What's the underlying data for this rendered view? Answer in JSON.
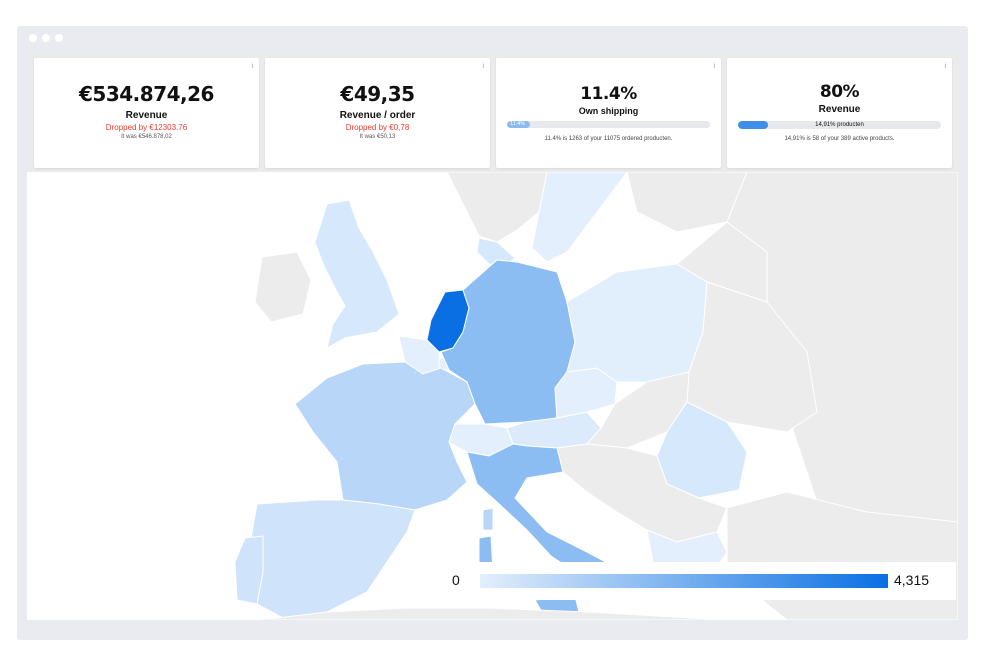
{
  "window": {
    "controls": [
      "close",
      "minimize",
      "maximize"
    ]
  },
  "cards": [
    {
      "value": "€534.874,26",
      "label": "Revenue",
      "change": "Dropped by €12303.76",
      "previous": "It was €546.878,02",
      "info_icon": "i"
    },
    {
      "value": "€49,35",
      "label": "Revenue / order",
      "change": "Dropped by €0,78",
      "previous": "It was €50,13",
      "info_icon": "i"
    },
    {
      "value": "11.4%",
      "label": "Own shipping",
      "progress_label": "11.4%",
      "progress": 0.114,
      "detail": "11.4% is 1263 of your 11075 ordered producten.",
      "info_icon": "i"
    },
    {
      "value": "80%",
      "label": "Revenue",
      "progress_label": "14,91% producten",
      "progress": 0.1491,
      "detail": "14,91% is 58 of your 389 active products.",
      "info_icon": "i"
    }
  ],
  "legend": {
    "min": "0",
    "max": "4,315",
    "color_low": "#e3effc",
    "color_high": "#0a6fe3"
  },
  "map_colors": {
    "netherlands": "#0a6fe3",
    "germany": "#8bbdf2",
    "italy": "#8bbdf2",
    "france": "#b8d7f8",
    "spain": "#cfe3fb",
    "uk": "#d6e8fb",
    "poland": "#e1eefc",
    "romania": "#d6e8fb",
    "belgium": "#e3effc",
    "switzerland": "#e3effc",
    "austria": "#dbebfc",
    "czech": "#e3effc",
    "denmark": "#d6e8fb",
    "sweden": "#e3effc",
    "greece": "#e3effc",
    "other": "#ececec"
  }
}
